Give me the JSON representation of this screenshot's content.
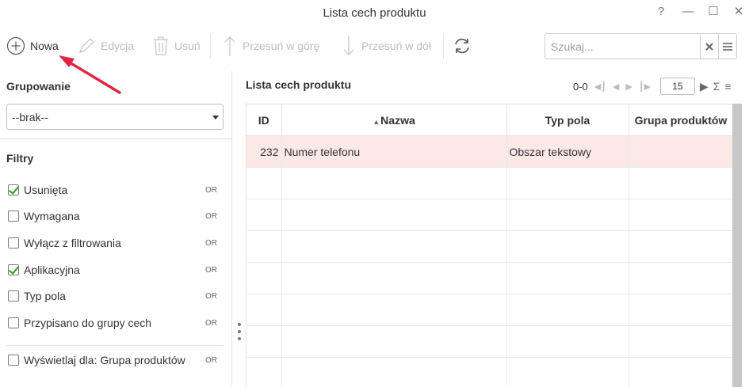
{
  "window": {
    "title": "Lista cech produktu",
    "help": "?",
    "minimize": "—",
    "maximize": "☐",
    "close": "✕"
  },
  "toolbar": {
    "new_label": "Nowa",
    "edit_label": "Edycja",
    "delete_label": "Usuń",
    "move_up_label": "Przesuń w górę",
    "move_down_label": "Przesuń w dół"
  },
  "search": {
    "placeholder": "Szukaj..."
  },
  "left_panel": {
    "grouping_title": "Grupowanie",
    "grouping_value": "--brak--",
    "filters_title": "Filtry",
    "filters": [
      {
        "label": "Usunięta",
        "checked": true,
        "or": "OR"
      },
      {
        "label": "Wymagana",
        "checked": false,
        "or": "OR"
      },
      {
        "label": "Wyłącz z filtrowania",
        "checked": false,
        "or": "OR"
      },
      {
        "label": "Aplikacyjna",
        "checked": true,
        "or": "OR"
      },
      {
        "label": "Typ pola",
        "checked": false,
        "or": "OR"
      },
      {
        "label": "Przypisano do grupy cech",
        "checked": false,
        "or": "OR"
      }
    ],
    "display_for": {
      "label": "Wyświetlaj dla: Grupa produktów",
      "checked": false,
      "or": "OR"
    }
  },
  "list": {
    "title": "Lista cech produktu",
    "pager": {
      "range": "0-0",
      "page_size": "15"
    },
    "columns": [
      "ID",
      "Nazwa",
      "Typ pola",
      "Grupa produktów"
    ],
    "rows": [
      {
        "id": "232",
        "name": "Numer telefonu",
        "type": "Obszar tekstowy",
        "group": ""
      }
    ]
  },
  "colors": {
    "accent_check": "#3a9a2c",
    "selected_row": "#fde8e8",
    "annotation_arrow": "#e0253f"
  }
}
